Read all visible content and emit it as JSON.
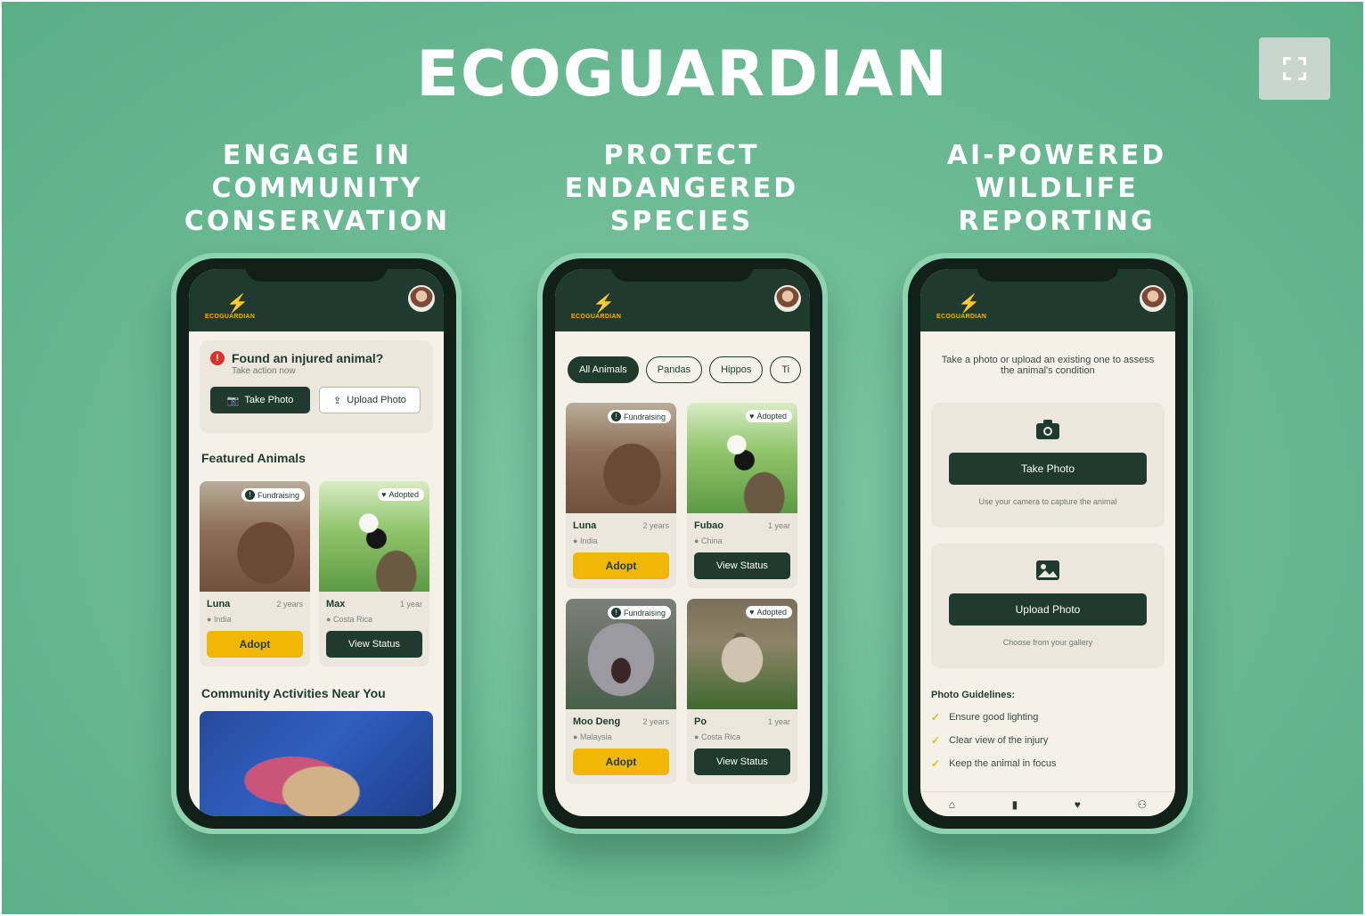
{
  "page": {
    "title": "ECOGUARDIAN",
    "expand_icon": "expand-icon"
  },
  "columns": [
    {
      "heading": "ENGAGE IN\nCOMMUNITY\nCONSERVATION"
    },
    {
      "heading": "PROTECT\nENDANGERED\nSPECIES"
    },
    {
      "heading": "AI-POWERED\nWILDLIFE\nREPORTING"
    }
  ],
  "app": {
    "logo_text": "ECOGUARDIAN",
    "brand_color": "#1f3a2e",
    "accent_color": "#f2b705",
    "alert_color": "#d8322b"
  },
  "phone1": {
    "alert": {
      "title": "Found an injured animal?",
      "subtitle": "Take action now",
      "take_photo": "Take Photo",
      "upload_photo": "Upload Photo"
    },
    "featured_title": "Featured Animals",
    "animals": [
      {
        "name": "Luna",
        "age": "2 years",
        "location": "India",
        "badge": "Fundraising",
        "action": "Adopt"
      },
      {
        "name": "Max",
        "age": "1 year",
        "location": "Costa Rica",
        "badge": "Adopted",
        "action": "View Status"
      }
    ],
    "community_title": "Community Activities Near You"
  },
  "phone2": {
    "filters": [
      "All Animals",
      "Pandas",
      "Hippos",
      "Ti"
    ],
    "animals": [
      {
        "name": "Luna",
        "age": "2 years",
        "location": "India",
        "badge": "Fundraising",
        "action": "Adopt"
      },
      {
        "name": "Fubao",
        "age": "1 year",
        "location": "China",
        "badge": "Adopted",
        "action": "View Status"
      },
      {
        "name": "Moo Deng",
        "age": "2 years",
        "location": "Malaysia",
        "badge": "Fundraising",
        "action": "Adopt"
      },
      {
        "name": "Po",
        "age": "1 year",
        "location": "Costa Rica",
        "badge": "Adopted",
        "action": "View Status"
      }
    ]
  },
  "phone3": {
    "intro": "Take a photo or upload an existing one to assess the animal's condition",
    "take_photo": {
      "label": "Take Photo",
      "hint": "Use your camera to capture the animal"
    },
    "upload_photo": {
      "label": "Upload Photo",
      "hint": "Choose from your gallery"
    },
    "guidelines_title": "Photo Guidelines:",
    "guidelines": [
      "Ensure good lighting",
      "Clear view of the injury",
      "Keep the animal in focus"
    ]
  }
}
